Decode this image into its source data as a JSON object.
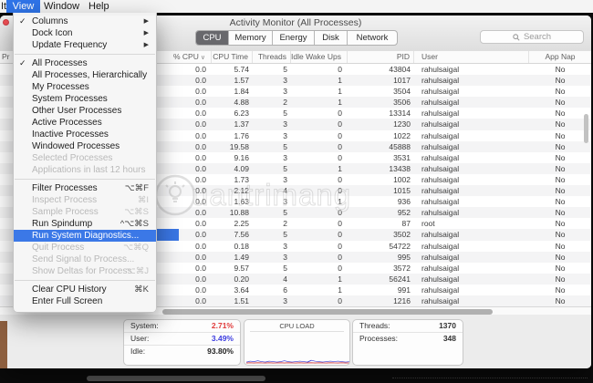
{
  "menu_bar": {
    "items": [
      {
        "label": "It",
        "selected": false
      },
      {
        "label": "View",
        "selected": true
      },
      {
        "label": "Window",
        "selected": false
      },
      {
        "label": "Help",
        "selected": false
      }
    ]
  },
  "view_menu": {
    "check_glyph": "✓",
    "submenu_glyph": "▶",
    "sections": [
      {
        "items": [
          {
            "label": "Columns",
            "checked": true,
            "submenu": true
          },
          {
            "label": "Dock Icon",
            "submenu": true
          },
          {
            "label": "Update Frequency",
            "submenu": true
          }
        ]
      },
      {
        "items": [
          {
            "label": "All Processes",
            "checked": true
          },
          {
            "label": "All Processes, Hierarchically"
          },
          {
            "label": "My Processes"
          },
          {
            "label": "System Processes"
          },
          {
            "label": "Other User Processes"
          },
          {
            "label": "Active Processes"
          },
          {
            "label": "Inactive Processes"
          },
          {
            "label": "Windowed Processes"
          },
          {
            "label": "Selected Processes",
            "disabled": true
          },
          {
            "label": "Applications in last 12 hours",
            "disabled": true
          }
        ]
      },
      {
        "items": [
          {
            "label": "Filter Processes",
            "shortcut": "⌥⌘F"
          },
          {
            "label": "Inspect Process",
            "shortcut": "⌘I",
            "disabled": true
          },
          {
            "label": "Sample Process",
            "shortcut": "⌥⌘S",
            "disabled": true
          },
          {
            "label": "Run Spindump",
            "shortcut": "^⌥⌘S"
          },
          {
            "label": "Run System Diagnostics...",
            "highlighted": true
          },
          {
            "label": "Quit Process",
            "shortcut": "⌥⌘Q",
            "disabled": true
          },
          {
            "label": "Send Signal to Process...",
            "disabled": true
          },
          {
            "label": "Show Deltas for Process",
            "shortcut": "⌥⌘J",
            "disabled": true
          }
        ]
      },
      {
        "items": [
          {
            "label": "Clear CPU History",
            "shortcut": "⌘K"
          },
          {
            "label": "Enter Full Screen"
          }
        ]
      }
    ]
  },
  "window": {
    "title": "Activity Monitor (All Processes)",
    "search_placeholder": "Search",
    "partial_header": "Pr",
    "tabs": [
      {
        "label": "CPU",
        "selected": true
      },
      {
        "label": "Memory",
        "selected": false
      },
      {
        "label": "Energy",
        "selected": false
      },
      {
        "label": "Disk",
        "selected": false
      },
      {
        "label": "Network",
        "selected": false
      }
    ]
  },
  "table": {
    "columns": [
      "% CPU",
      "CPU Time",
      "Threads",
      "Idle Wake Ups",
      "PID",
      "User",
      "App Nap"
    ],
    "sort_column": "% CPU",
    "sort_indicator": "∨",
    "selected_row_index": 15,
    "rows": [
      [
        "0.0",
        "5.74",
        "5",
        "0",
        "43804",
        "rahulsaigal",
        "No"
      ],
      [
        "0.0",
        "1.57",
        "3",
        "1",
        "1017",
        "rahulsaigal",
        "No"
      ],
      [
        "0.0",
        "1.84",
        "3",
        "1",
        "3504",
        "rahulsaigal",
        "No"
      ],
      [
        "0.0",
        "4.88",
        "2",
        "1",
        "3506",
        "rahulsaigal",
        "No"
      ],
      [
        "0.0",
        "6.23",
        "5",
        "0",
        "13314",
        "rahulsaigal",
        "No"
      ],
      [
        "0.0",
        "1.37",
        "3",
        "0",
        "1230",
        "rahulsaigal",
        "No"
      ],
      [
        "0.0",
        "1.76",
        "3",
        "0",
        "1022",
        "rahulsaigal",
        "No"
      ],
      [
        "0.0",
        "19.58",
        "5",
        "0",
        "45888",
        "rahulsaigal",
        "No"
      ],
      [
        "0.0",
        "9.16",
        "3",
        "0",
        "3531",
        "rahulsaigal",
        "No"
      ],
      [
        "0.0",
        "4.09",
        "5",
        "1",
        "13438",
        "rahulsaigal",
        "No"
      ],
      [
        "0.0",
        "1.73",
        "3",
        "0",
        "1002",
        "rahulsaigal",
        "No"
      ],
      [
        "0.0",
        "2.12",
        "4",
        "0",
        "1015",
        "rahulsaigal",
        "No"
      ],
      [
        "0.0",
        "1.63",
        "3",
        "1",
        "936",
        "rahulsaigal",
        "No"
      ],
      [
        "0.0",
        "10.88",
        "5",
        "0",
        "952",
        "rahulsaigal",
        "No"
      ],
      [
        "0.0",
        "2.25",
        "2",
        "0",
        "87",
        "root",
        "No"
      ],
      [
        "0.0",
        "7.56",
        "5",
        "0",
        "3502",
        "rahulsaigal",
        "No"
      ],
      [
        "0.0",
        "0.18",
        "3",
        "0",
        "54722",
        "rahulsaigal",
        "No"
      ],
      [
        "0.0",
        "1.49",
        "3",
        "0",
        "995",
        "rahulsaigal",
        "No"
      ],
      [
        "0.0",
        "9.57",
        "5",
        "0",
        "3572",
        "rahulsaigal",
        "No"
      ],
      [
        "0.0",
        "0.20",
        "4",
        "1",
        "56241",
        "rahulsaigal",
        "No"
      ],
      [
        "0.0",
        "3.64",
        "6",
        "1",
        "991",
        "rahulsaigal",
        "No"
      ],
      [
        "0.0",
        "1.51",
        "3",
        "0",
        "1216",
        "rahulsaigal",
        "No"
      ]
    ]
  },
  "footer": {
    "graph_title": "CPU LOAD",
    "stats_left": [
      {
        "label": "System:",
        "value": "2.71%",
        "color": "#e03a3a"
      },
      {
        "label": "User:",
        "value": "3.49%",
        "color": "#3c3cdf"
      },
      {
        "label": "Idle:",
        "value": "93.80%",
        "color": "#222222"
      }
    ],
    "stats_right": [
      {
        "label": "Threads:",
        "value": "1370"
      },
      {
        "label": "Processes:",
        "value": "348"
      }
    ],
    "cpu_load_history_user": [
      2,
      3,
      2.5,
      3.5,
      2.5,
      2,
      3,
      2.5,
      2,
      2.5,
      3.5,
      2.5,
      2,
      2.5,
      3,
      2.5,
      2,
      4,
      3,
      2.5,
      2,
      2.5,
      3,
      2.5,
      3,
      2.5,
      2,
      2.5
    ],
    "cpu_load_history_system": [
      1,
      1.2,
      1,
      1.3,
      1.1,
      1,
      1.2,
      1,
      1.1,
      1.3,
      1,
      1.2,
      1.1,
      1,
      1.2,
      1,
      1.1,
      1.2,
      1,
      1.3,
      1.1,
      1,
      1.2,
      1.1,
      1,
      1.2,
      1,
      1.1
    ]
  },
  "watermark": {
    "text": "uantrimang"
  },
  "colors": {
    "menu_highlight": "#3b78e7",
    "menubar_selection": "#2f74e8",
    "selected_tab": "#68686c",
    "selection_sliver": "#3a76e4",
    "system_stat": "#e03a3a",
    "user_stat": "#3c3cdf",
    "load_line_user": "#4444d8",
    "load_line_system": "#d23b3b"
  }
}
